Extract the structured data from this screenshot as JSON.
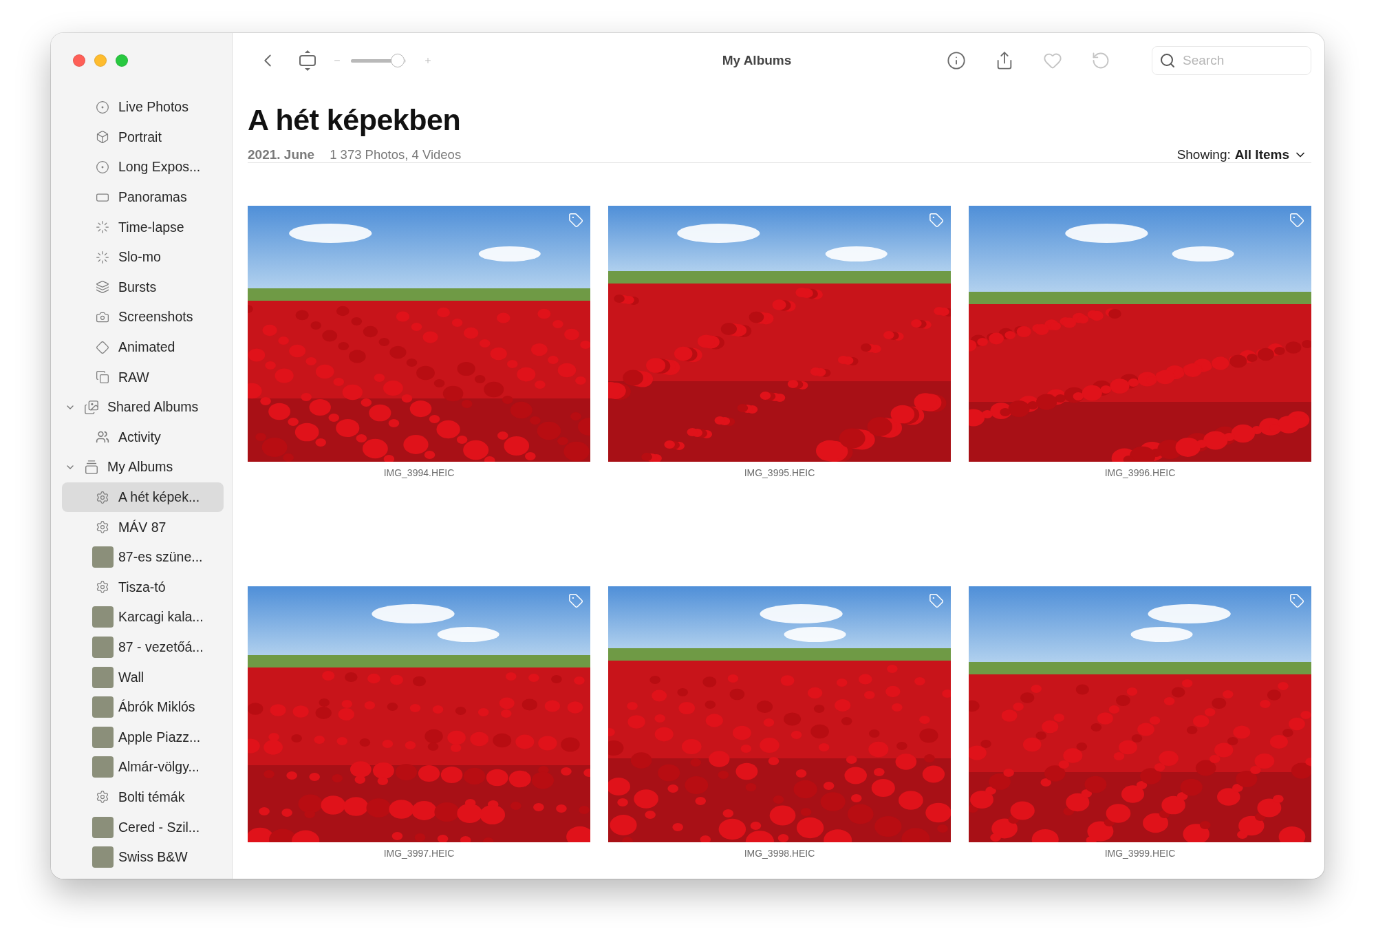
{
  "toolbar": {
    "title": "My Albums",
    "zoom": {
      "level": 0.85
    },
    "actions": [
      {
        "kind": "info",
        "disabled": false
      },
      {
        "kind": "share",
        "disabled": false
      },
      {
        "kind": "favorite",
        "disabled": true
      },
      {
        "kind": "rotate",
        "disabled": true
      }
    ],
    "search": {
      "placeholder": "Search"
    }
  },
  "sidebar": {
    "media_types": [
      "Live Photos",
      "Portrait",
      "Long Expos...",
      "Panoramas",
      "Time-lapse",
      "Slo-mo",
      "Bursts",
      "Screenshots",
      "Animated",
      "RAW"
    ],
    "shared_albums": {
      "label": "Shared Albums",
      "expanded": true,
      "items": [
        {
          "label": "Activity"
        }
      ]
    },
    "my_albums": {
      "label": "My Albums",
      "expanded": true,
      "items": [
        {
          "label": "A hét képek...",
          "kind": "smart",
          "selected": true
        },
        {
          "label": "MÁV 87",
          "kind": "smart",
          "selected": false
        },
        {
          "label": "87-es szüne...",
          "kind": "thumb",
          "selected": false
        },
        {
          "label": "Tisza-tó",
          "kind": "smart",
          "selected": false
        },
        {
          "label": "Karcagi kala...",
          "kind": "thumb",
          "selected": false
        },
        {
          "label": "87 - vezetőá...",
          "kind": "thumb",
          "selected": false
        },
        {
          "label": "Wall",
          "kind": "thumb",
          "selected": false
        },
        {
          "label": "Ábrók Miklós",
          "kind": "thumb",
          "selected": false
        },
        {
          "label": "Apple Piazz...",
          "kind": "thumb",
          "selected": false
        },
        {
          "label": "Almár-völgy...",
          "kind": "thumb",
          "selected": false
        },
        {
          "label": "Bolti témák",
          "kind": "smart",
          "selected": false
        },
        {
          "label": "Cered - Szil...",
          "kind": "thumb",
          "selected": false
        },
        {
          "label": "Swiss B&W",
          "kind": "thumb",
          "selected": false
        }
      ]
    }
  },
  "album": {
    "title": "A hét képekben",
    "date": "2021. June",
    "counts": "1 373 Photos, 4 Videos",
    "filter": {
      "label": "Showing:",
      "value": "All Items"
    }
  },
  "photos": [
    {
      "file": "IMG_3994.HEIC"
    },
    {
      "file": "IMG_3995.HEIC"
    },
    {
      "file": "IMG_3996.HEIC"
    },
    {
      "file": "IMG_3997.HEIC"
    },
    {
      "file": "IMG_3998.HEIC"
    },
    {
      "file": "IMG_3999.HEIC"
    }
  ]
}
